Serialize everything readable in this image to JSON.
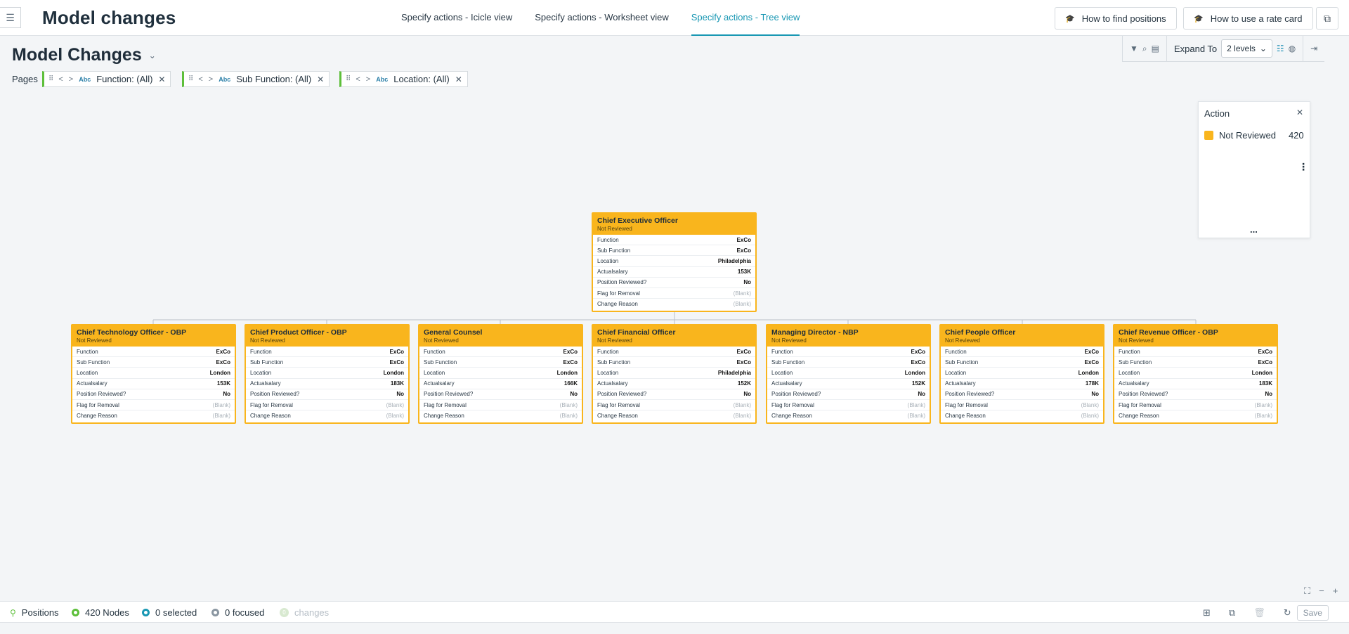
{
  "header": {
    "title": "Model changes",
    "tabs": [
      {
        "label": "Specify actions - Icicle view",
        "active": false
      },
      {
        "label": "Specify actions - Worksheet view",
        "active": false
      },
      {
        "label": "Specify actions - Tree view",
        "active": true
      }
    ],
    "help_find_positions": "How to find positions",
    "help_rate_card": "How to use a rate card"
  },
  "page": {
    "title": "Model Changes",
    "pages_label": "Pages",
    "filters": [
      {
        "type_tag": "Abc",
        "label": "Function: (All)"
      },
      {
        "type_tag": "Abc",
        "label": "Sub Function: (All)"
      },
      {
        "type_tag": "Abc",
        "label": "Location: (All)"
      }
    ]
  },
  "toolbar": {
    "expand_label": "Expand To",
    "expand_value": "2 levels"
  },
  "legend": {
    "title": "Action",
    "items": [
      {
        "label": "Not Reviewed",
        "count": "420",
        "color": "#f9b51d"
      }
    ],
    "more": "..."
  },
  "field_labels": [
    "Function",
    "Sub Function",
    "Location",
    "Actualsalary",
    "Position Reviewed?",
    "Flag for Removal",
    "Change Reason"
  ],
  "org": {
    "root": {
      "title": "Chief Executive Officer",
      "status": "Not Reviewed",
      "values": [
        "ExCo",
        "ExCo",
        "Philadelphia",
        "153K",
        "No",
        "(Blank)",
        "(Blank)"
      ]
    },
    "children": [
      {
        "title": "Chief Technology Officer - OBP",
        "status": "Not Reviewed",
        "values": [
          "ExCo",
          "ExCo",
          "London",
          "153K",
          "No",
          "(Blank)",
          "(Blank)"
        ]
      },
      {
        "title": "Chief Product Officer - OBP",
        "status": "Not Reviewed",
        "values": [
          "ExCo",
          "ExCo",
          "London",
          "183K",
          "No",
          "(Blank)",
          "(Blank)"
        ]
      },
      {
        "title": "General Counsel",
        "status": "Not Reviewed",
        "values": [
          "ExCo",
          "ExCo",
          "London",
          "166K",
          "No",
          "(Blank)",
          "(Blank)"
        ]
      },
      {
        "title": "Chief Financial Officer",
        "status": "Not Reviewed",
        "values": [
          "ExCo",
          "ExCo",
          "Philadelphia",
          "152K",
          "No",
          "(Blank)",
          "(Blank)"
        ]
      },
      {
        "title": "Managing Director - NBP",
        "status": "Not Reviewed",
        "values": [
          "ExCo",
          "ExCo",
          "London",
          "152K",
          "No",
          "(Blank)",
          "(Blank)"
        ]
      },
      {
        "title": "Chief People Officer",
        "status": "Not Reviewed",
        "values": [
          "ExCo",
          "ExCo",
          "London",
          "178K",
          "No",
          "(Blank)",
          "(Blank)"
        ]
      },
      {
        "title": "Chief Revenue Officer - OBP",
        "status": "Not Reviewed",
        "values": [
          "ExCo",
          "ExCo",
          "London",
          "183K",
          "No",
          "(Blank)",
          "(Blank)"
        ]
      }
    ]
  },
  "statusbar": {
    "positions": "Positions",
    "nodes": "420 Nodes",
    "selected": "0 selected",
    "focused": "0 focused",
    "changes_count": "0",
    "changes": "changes",
    "save": "Save"
  }
}
